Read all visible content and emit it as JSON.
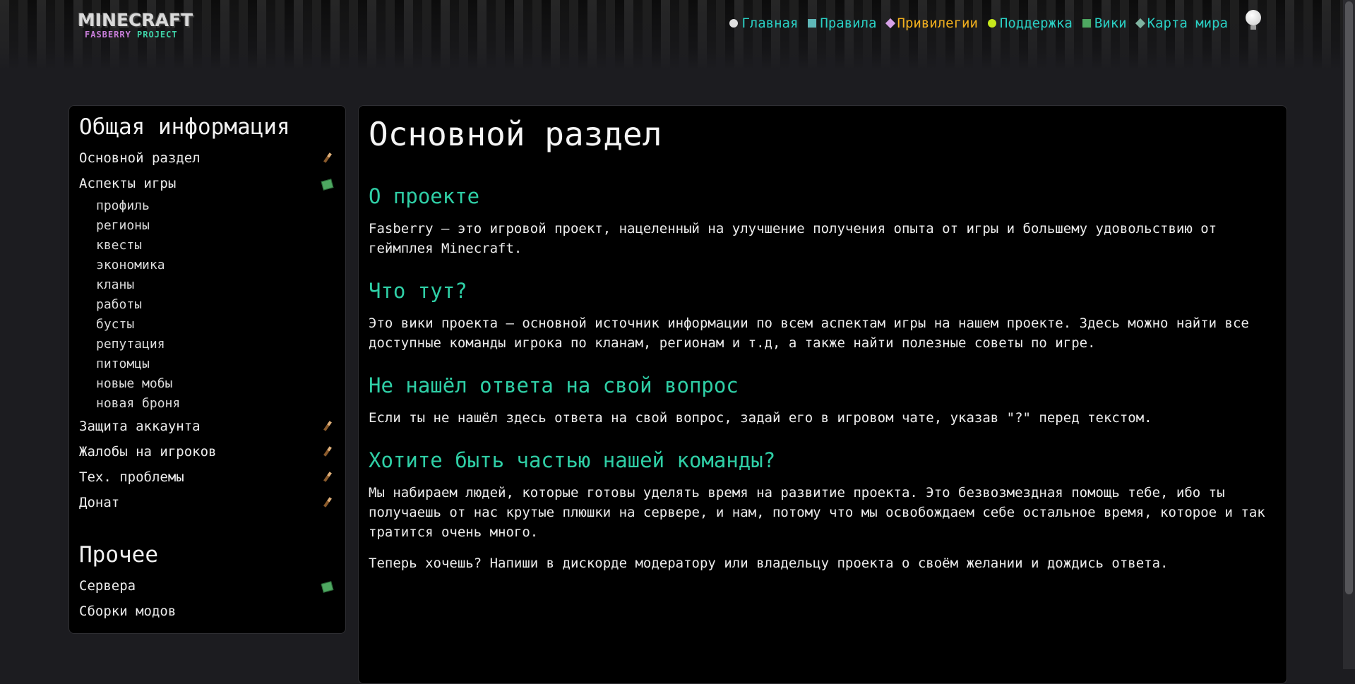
{
  "header": {
    "logo": {
      "main": "MINECRAFT",
      "sub_part1": "FASBERRY",
      "sub_part2": "PROJECT"
    },
    "nav": [
      {
        "label": "Главная",
        "icon": "home-icon"
      },
      {
        "label": "Правила",
        "icon": "rules-icon"
      },
      {
        "label": "Привилегии",
        "icon": "privileges-icon",
        "active": true
      },
      {
        "label": "Поддержка",
        "icon": "support-icon"
      },
      {
        "label": "Вики",
        "icon": "wiki-icon"
      },
      {
        "label": "Карта мира",
        "icon": "map-icon"
      }
    ],
    "theme_toggle_icon": "lightbulb-icon"
  },
  "sidebar": {
    "heading_general": "Общая информация",
    "items": [
      {
        "label": "Основной раздел",
        "icon": "brush-icon"
      },
      {
        "label": "Аспекты игры",
        "icon": "book-icon"
      },
      {
        "label": "Защита аккаунта",
        "icon": "brush-icon"
      },
      {
        "label": "Жалобы на игроков",
        "icon": "brush-icon"
      },
      {
        "label": "Тех. проблемы",
        "icon": "brush-icon"
      },
      {
        "label": "Донат",
        "icon": "brush-icon"
      }
    ],
    "subitems": [
      "профиль",
      "регионы",
      "квесты",
      "экономика",
      "кланы",
      "работы",
      "бусты",
      "репутация",
      "питомцы",
      "новые мобы",
      "новая броня"
    ],
    "heading_other": "Прочее",
    "other_items": [
      {
        "label": "Сервера",
        "icon": "book-icon"
      },
      {
        "label": "Сборки модов",
        "icon": ""
      }
    ]
  },
  "main": {
    "title": "Основной раздел",
    "sections": [
      {
        "heading": "О проекте",
        "paragraphs": [
          "Fasberry – это игровой проект, нацеленный на улучшение получения опыта от игры и большему удовольствию от геймплея Minecraft."
        ]
      },
      {
        "heading": "Что тут?",
        "paragraphs": [
          "Это вики проекта – основной источник информации по всем аспектам игры на нашем проекте. Здесь можно найти все доступные команды игрока по кланам, регионам и т.д, а также найти полезные советы по игре."
        ]
      },
      {
        "heading": "Не нашёл ответа на свой вопрос",
        "paragraphs": [
          "Если ты не нашёл здесь ответа на свой вопрос, задай его в игровом чате, указав \"?\" перед текстом."
        ]
      },
      {
        "heading": "Хотите быть частью нашей команды?",
        "paragraphs": [
          "Мы набираем людей, которые готовы уделять время на развитие проекта. Это безвозмездная помощь тебе, ибо ты получаешь от нас крутые плюшки на сервере, и нам, потому что мы освобождаем себе остальное время, которое и так тратится очень много.",
          "Теперь хочешь? Напиши в дискорде модератору или владельцу проекта о своём желании и дождись ответа."
        ]
      }
    ]
  },
  "colors": {
    "accent_teal": "#2fcfa6",
    "nav_link": "#2ad0c4",
    "nav_active": "#f2b01e",
    "background": "#1c1c20",
    "panel": "#000000"
  }
}
